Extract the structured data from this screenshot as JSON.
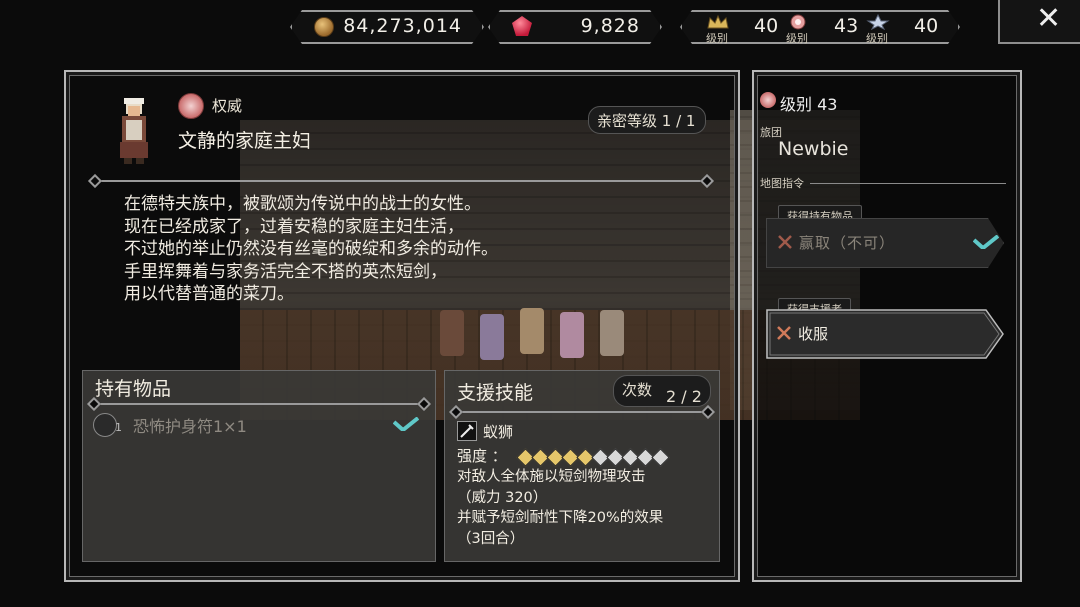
{
  "currency": {
    "money": "84,273,014",
    "gems": "9,828",
    "ranks": [
      {
        "caption": "级别",
        "value": "40",
        "icon": "gold-crest-icon"
      },
      {
        "caption": "级别",
        "value": "43",
        "icon": "pink-crest-icon"
      },
      {
        "caption": "级别",
        "value": "40",
        "icon": "silver-crest-icon"
      }
    ]
  },
  "close_label": "✕",
  "character": {
    "job_label": "权威",
    "name": "文静的家庭主妇",
    "intimacy": "亲密等级 1 / 1",
    "description": [
      "在德特夫族中，被歌颂为传说中的战士的女性。",
      "现在已经成家了，过着安稳的家庭主妇生活，",
      "不过她的举止仍然没有丝毫的破绽和多余的动作。",
      "手里挥舞着与家务活完全不搭的英杰短剑，",
      "用以代替普通的菜刀。"
    ]
  },
  "items": {
    "title": "持有物品",
    "list": [
      {
        "count": "1",
        "name": "恐怖护身符1×1",
        "icon": "amulet-icon"
      }
    ]
  },
  "skill": {
    "title": "支援技能",
    "uses_label": "次数",
    "uses_value": "2 / 2",
    "name": "蚁狮",
    "power_label": "强度 ：",
    "power_level": 5,
    "power_max": 10,
    "description": [
      "对敌人全体施以短剑物理攻击",
      "（威力 320）",
      "并赋予短剑耐性下降20%的效果",
      "（3回合）"
    ]
  },
  "side": {
    "level_text": "级别 43",
    "guild_label": "旅团",
    "guild_name": "Newbie",
    "map_cmd_label": "地图指令",
    "commands": [
      {
        "tag": "获得持有物品",
        "label": "赢取（不可）",
        "enabled": false
      },
      {
        "tag": "获得支援者",
        "label": "收服",
        "enabled": true
      }
    ]
  },
  "colors": {
    "check": "#5fc8c8",
    "pip_on": "#e6c76a",
    "pip_off": "#d8d8d8",
    "frame": "#b8b8b8"
  }
}
